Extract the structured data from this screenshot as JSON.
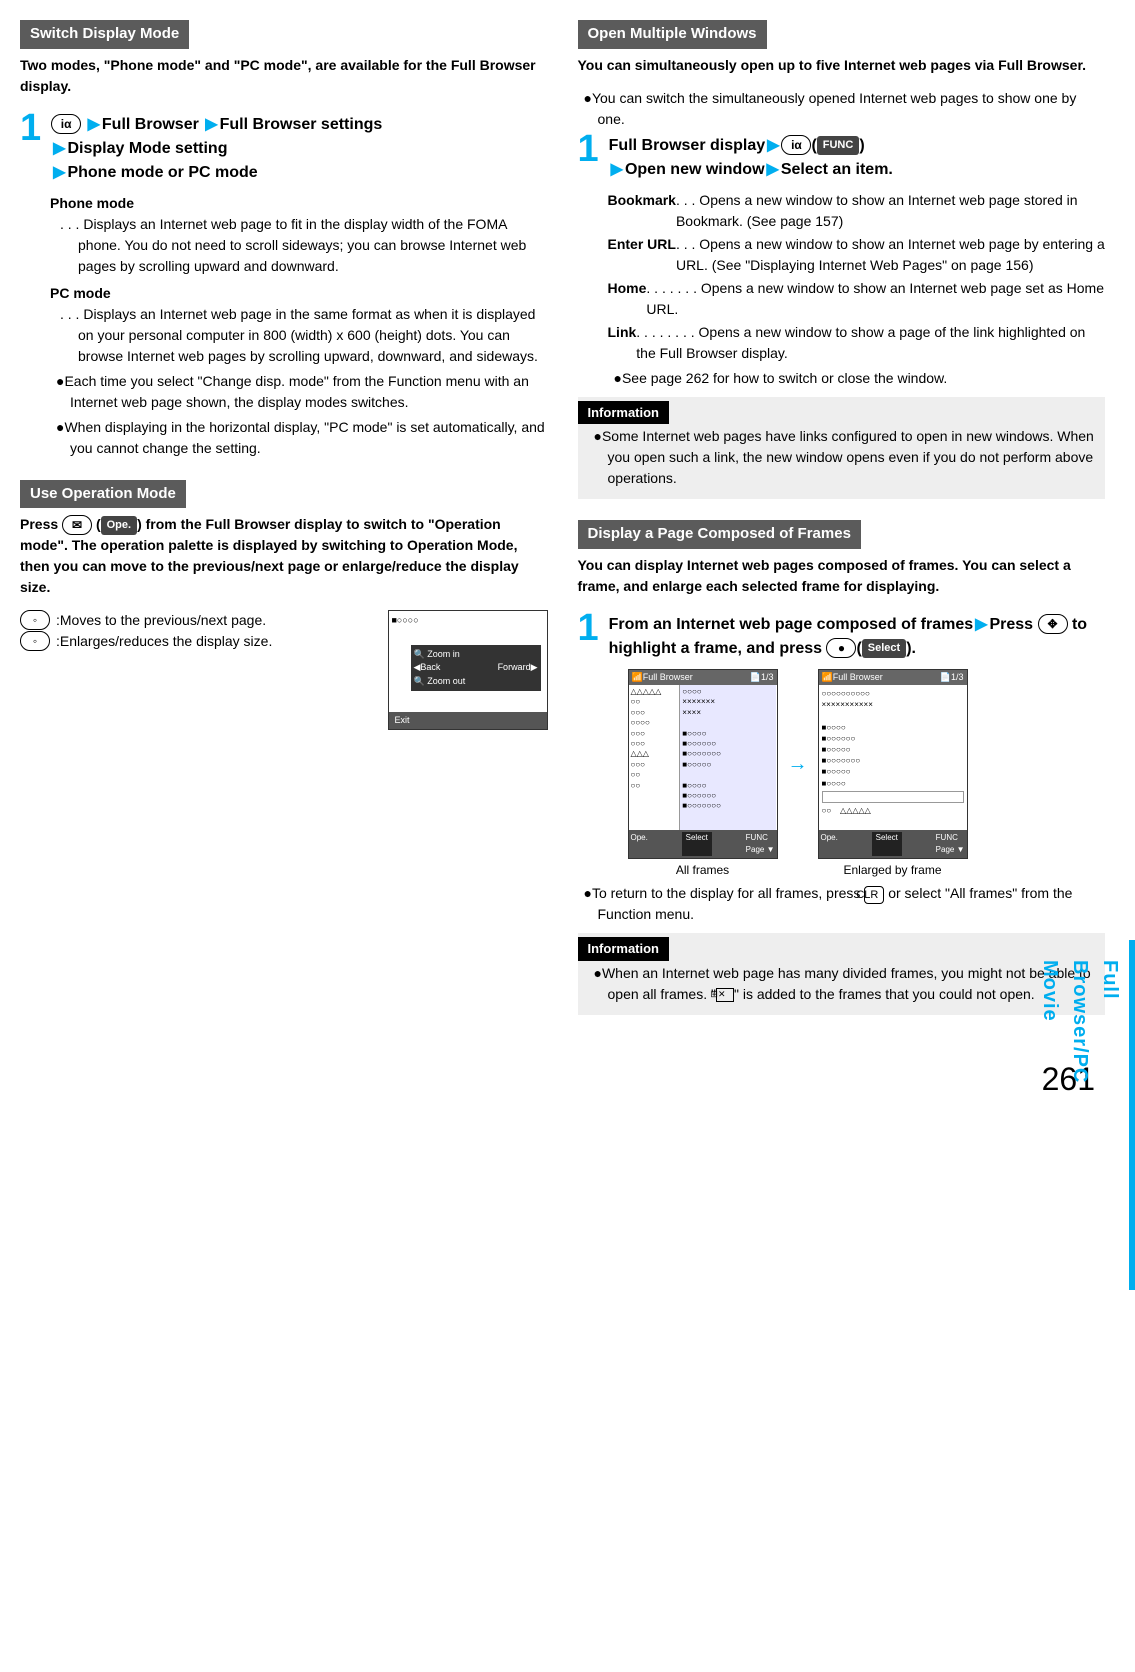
{
  "page_number": "261",
  "side_tab": "Full Browser/PC Movie",
  "left": {
    "switch_display": {
      "header": "Switch Display Mode",
      "intro": "Two modes, \"Phone mode\" and \"PC mode\", are available for the Full Browser display.",
      "step_num": "1",
      "step_line1_a": "Full Browser",
      "step_line1_b": "Full Browser settings",
      "step_line2": "Display Mode setting",
      "step_line3": "Phone mode or PC mode",
      "icon_label": "iα",
      "phone_mode_label": "Phone mode",
      "phone_mode_desc": ". . . Displays an Internet web page to fit in the display width of the FOMA phone. You do not need to scroll sideways; you can browse Internet web pages by scrolling upward and downward.",
      "pc_mode_label": "PC mode",
      "pc_mode_desc": ". . . Displays an Internet web page in the same format as when it is displayed on your personal computer in 800 (width) x 600 (height) dots. You can browse Internet web pages by scrolling upward, downward, and sideways.",
      "bullet1": "Each time you select \"Change disp. mode\" from the Function menu with an Internet web page shown, the display modes switches.",
      "bullet2": "When displaying in the horizontal display, \"PC mode\" is set automatically, and you cannot change the setting."
    },
    "use_operation": {
      "header": "Use Operation Mode",
      "intro_a": "Press ",
      "intro_b": " (",
      "intro_c": ") from the Full Browser display to switch to \"Operation mode\". The operation palette is displayed by switching to Operation Mode, then you can move to the previous/next page or enlarge/reduce the display size.",
      "mail_icon": "✉",
      "ope_label": "Ope.",
      "row1": ":Moves to the previous/next page.",
      "row2": ":Enlarges/reduces the display size.",
      "palette": {
        "zoom_in": "Zoom in",
        "zoom_out": "Zoom out",
        "back": "◀Back",
        "forward": "Forward▶",
        "exit": "Exit"
      }
    }
  },
  "right": {
    "open_multiple": {
      "header": "Open Multiple Windows",
      "intro": "You can simultaneously open up to five Internet web pages via Full Browser.",
      "bullet_intro": "You can switch the simultaneously opened Internet web pages to show one by one.",
      "step_num": "1",
      "step_line1_a": "Full Browser display",
      "step_line1_b": "(",
      "step_line1_c": ")",
      "icon_label": "iα",
      "func_label": "FUNC",
      "step_line2_a": "Open new window",
      "step_line2_b": "Select an item.",
      "items": {
        "bookmark_t": "Bookmark",
        "bookmark_d": " . . . Opens a new window to show an Internet web page stored in Bookmark. (See page 157)",
        "enterurl_t": "Enter URL",
        "enterurl_d": " . . . Opens a new window to show an Internet web page by entering a URL. (See \"Displaying Internet Web Pages\" on page 156)",
        "home_t": "Home",
        "home_d": " . . . . . . . Opens a new window to show an Internet web page set as Home URL.",
        "link_t": "Link",
        "link_d": " . . . . . . . . Opens a new window to show a page of the link highlighted on the Full Browser display."
      },
      "bullet_after": "See page 262 for how to switch or close the window.",
      "info_label": "Information",
      "info_text": "Some Internet web pages have links configured to open in new windows. When you open such a link, the new window opens even if you do not perform above operations."
    },
    "frames": {
      "header": "Display a Page Composed of Frames",
      "intro": "You can display Internet web pages composed of frames. You can select a frame, and enlarge each selected frame for displaying.",
      "step_num": "1",
      "step_line1": "From an Internet web page composed of frames",
      "step_line2_a": "Press ",
      "step_line2_b": " to highlight a frame, and press ",
      "step_line2_c": "(",
      "step_line2_d": ").",
      "select_label": "Select",
      "img_title": "Full Browser",
      "img_page": "1/3",
      "softkey_ope": "Ope.",
      "softkey_select": "Select",
      "softkey_func": "FUNC",
      "softkey_page": "Page ▼",
      "caption1": "All frames",
      "caption2": "Enlarged by frame",
      "bullet_return_a": "To return to the display for all frames, press ",
      "bullet_return_b": " or select \"All frames\" from the Function menu.",
      "clr_label": "CLR",
      "info_label": "Information",
      "info_text_a": "When an Internet web page has many divided frames, you might not be able to open all frames. \"",
      "info_text_b": "\" is added to the frames that you could not open."
    }
  }
}
